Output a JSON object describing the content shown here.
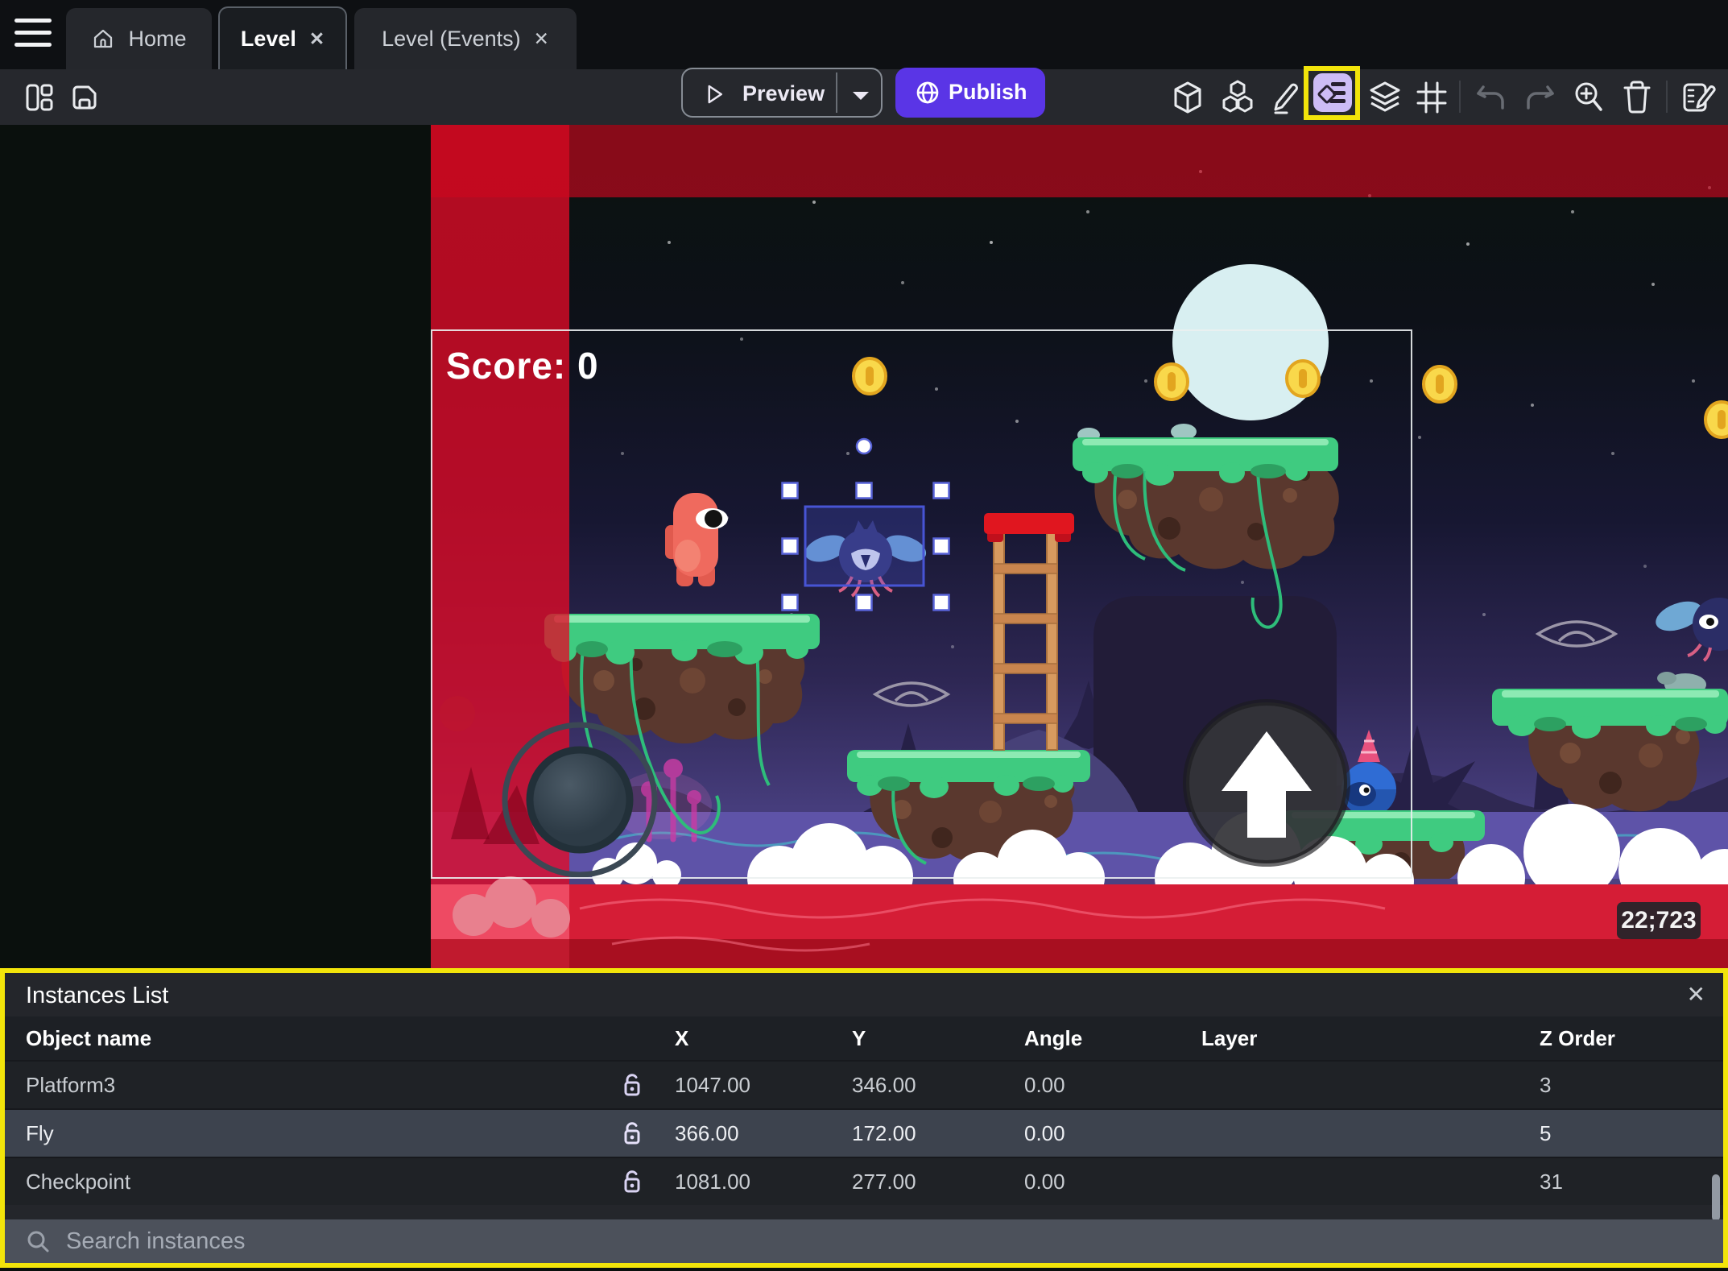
{
  "window": {
    "tabs": [
      {
        "label": "Home",
        "active": false
      },
      {
        "label": "Level",
        "active": true
      },
      {
        "label": "Level (Events)",
        "active": false
      }
    ]
  },
  "toolbar": {
    "preview_label": "Preview",
    "publish_label": "Publish",
    "left_icons": [
      "layout-panels",
      "save"
    ],
    "right_icons": [
      "cube-3d",
      "objects-group",
      "edit-pencil",
      "instances-list",
      "layers",
      "grid",
      "undo",
      "redo",
      "zoom-in",
      "delete",
      "scene-properties"
    ],
    "highlighted_icon": "instances-list"
  },
  "scene": {
    "score_label": "Score: 0",
    "coords_badge": "22;723",
    "selected_instance": "Fly",
    "objects": [
      "moon",
      "coins",
      "platforms",
      "player-character",
      "fly-enemy",
      "ladder",
      "checkpoint-enemy",
      "joystick-control",
      "jump-button",
      "clouds",
      "water"
    ]
  },
  "instances_panel": {
    "title": "Instances List",
    "columns": [
      "Object name",
      "X",
      "Y",
      "Angle",
      "Layer",
      "Z Order"
    ],
    "rows": [
      {
        "name": "Platform3",
        "lock": "unlocked",
        "x": "1047.00",
        "y": "346.00",
        "angle": "0.00",
        "layer": "",
        "z_order": "3",
        "selected": false
      },
      {
        "name": "Fly",
        "lock": "unlocked",
        "x": "366.00",
        "y": "172.00",
        "angle": "0.00",
        "layer": "",
        "z_order": "5",
        "selected": true
      },
      {
        "name": "Checkpoint",
        "lock": "unlocked",
        "x": "1081.00",
        "y": "277.00",
        "angle": "0.00",
        "layer": "",
        "z_order": "31",
        "selected": false
      }
    ],
    "search_placeholder": "Search instances"
  },
  "icons": {
    "close": "✕"
  },
  "colors": {
    "publish_purple": "#5a35e6",
    "highlight_yellow": "#f2e40a",
    "selection_blue": "#4754d4",
    "selected_row": "#3d434e",
    "scene_red_overlay": "#d51d36"
  }
}
